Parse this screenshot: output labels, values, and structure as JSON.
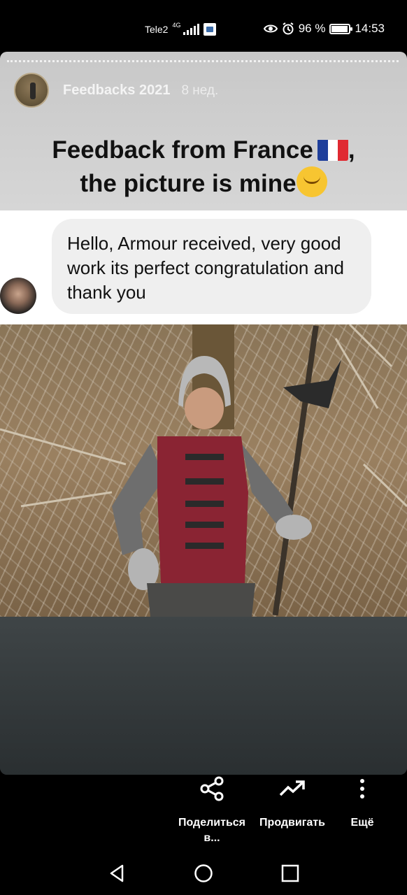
{
  "status_bar": {
    "carrier": "Tele2",
    "network": "4G",
    "battery_percent": "96 %",
    "time": "14:53"
  },
  "story": {
    "username": "Feedbacks 2021",
    "time_ago": "8 нед.",
    "headline_line1": "Feedback from France",
    "headline_line2": "the picture is mine",
    "message": "Hello, Armour received, very good work its perfect congratulation and thank you"
  },
  "actions": [
    {
      "label": "Поделиться в...",
      "icon": "share-icon"
    },
    {
      "label": "Продвигать",
      "icon": "trending-up-icon"
    },
    {
      "label": "Ещё",
      "icon": "more-vertical-icon"
    }
  ],
  "nav": {
    "back_icon": "back-triangle-icon",
    "home_icon": "home-circle-icon",
    "recents_icon": "recents-square-icon"
  },
  "colors": {
    "flag_blue": "#1f3f9b",
    "flag_white": "#ffffff",
    "flag_red": "#e02a32",
    "bubble_bg": "#efefef"
  }
}
